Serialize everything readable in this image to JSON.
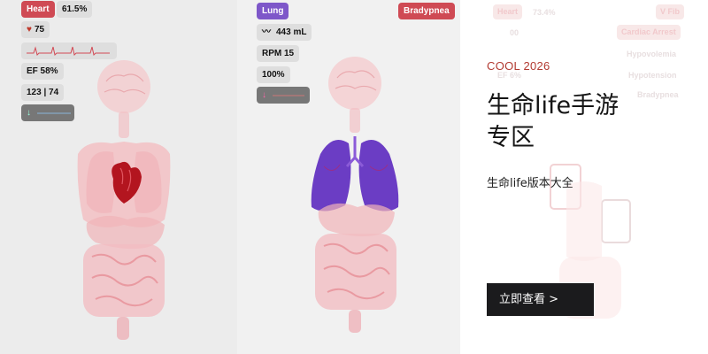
{
  "heart_panel": {
    "organ_badge": "Heart",
    "percent": "61.5%",
    "heart_rate": "75",
    "ef": "EF 58%",
    "blood_pressure": "123 | 74",
    "colors": {
      "badge": "#cf4a54",
      "heart": "#b3151f",
      "body": "#f2b8bd"
    }
  },
  "lung_panel": {
    "organ_badge": "Lung",
    "status_badge": "Bradypnea",
    "volume": "443 mL",
    "rpm": "RPM 15",
    "oxygen": "100%",
    "colors": {
      "badge": "#7e57c9",
      "status": "#cf4a54",
      "lungs": "#6b3dc4"
    }
  },
  "promo": {
    "ghost_ui": {
      "heart_badge": "Heart",
      "percent": "73.4%",
      "vfib": "V Fib",
      "rate": "00",
      "cardiac_arrest": "Cardiac Arrest",
      "hypovolemia": "Hypovolemia",
      "ef": "EF 6%",
      "hypotension": "Hypotension",
      "bradypnea": "Bradypnea"
    },
    "kicker": "COOL 2026",
    "title": "生命life手游专区",
    "subtitle": "生命life版本大全",
    "cta": "立即查看 >",
    "colors": {
      "kicker": "#b23a31",
      "cta_bg": "#1b1b1d"
    }
  }
}
